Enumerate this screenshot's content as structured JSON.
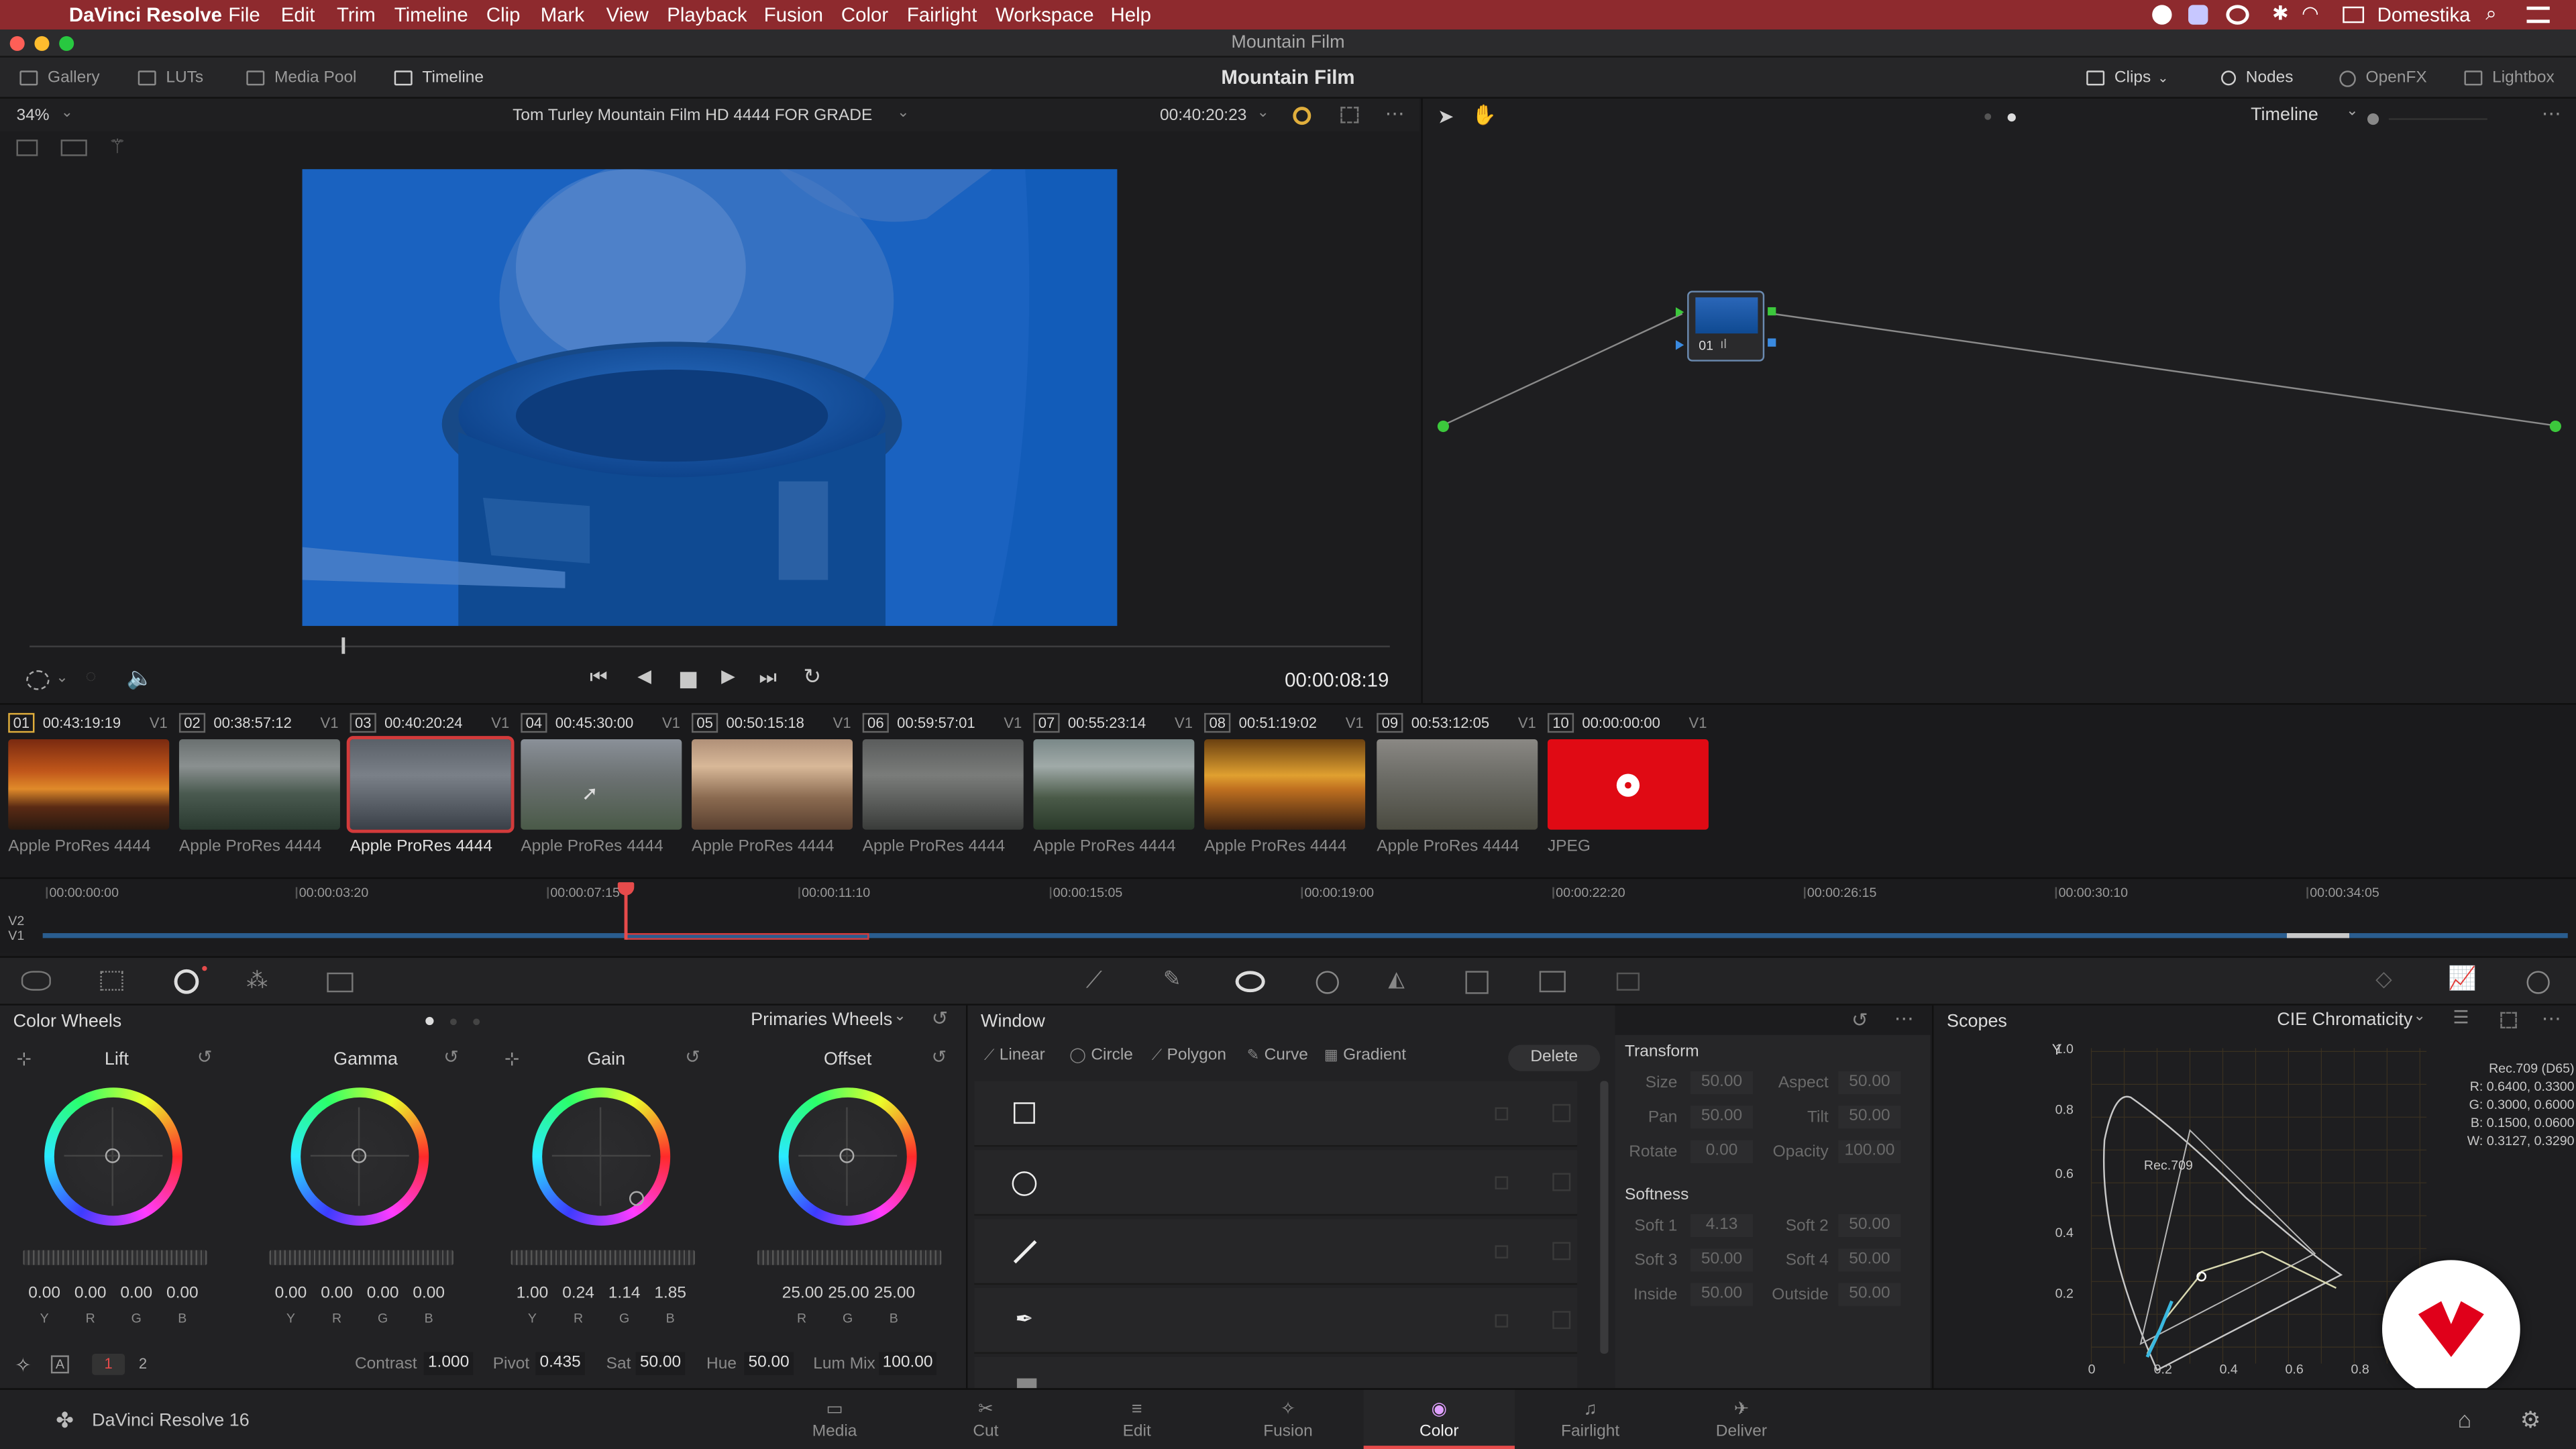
{
  "menubar": {
    "app": "DaVinci Resolve",
    "items": [
      "File",
      "Edit",
      "Trim",
      "Timeline",
      "Clip",
      "Mark",
      "View",
      "Playback",
      "Fusion",
      "Color",
      "Fairlight",
      "Workspace",
      "Help"
    ],
    "user": "Domestika"
  },
  "window_title": "Mountain Film",
  "toolbar": {
    "gallery": "Gallery",
    "luts": "LUTs",
    "media_pool": "Media Pool",
    "timeline": "Timeline",
    "project_title": "Mountain Film",
    "clips": "Clips",
    "nodes": "Nodes",
    "openfx": "OpenFX",
    "lightbox": "Lightbox"
  },
  "viewer": {
    "zoom": "34%",
    "timeline_name": "Tom Turley Mountain Film HD 4444 FOR GRADE",
    "source_tc": "00:40:20:23",
    "record_tc": "00:00:08:19"
  },
  "node_panel": {
    "mode": "Timeline",
    "node_label": "01"
  },
  "clips": [
    {
      "num": "01",
      "tc": "00:43:19:19",
      "track": "V1",
      "codec": "Apple ProRes 4444"
    },
    {
      "num": "02",
      "tc": "00:38:57:12",
      "track": "V1",
      "codec": "Apple ProRes 4444"
    },
    {
      "num": "03",
      "tc": "00:40:20:24",
      "track": "V1",
      "codec": "Apple ProRes 4444"
    },
    {
      "num": "04",
      "tc": "00:45:30:00",
      "track": "V1",
      "codec": "Apple ProRes 4444"
    },
    {
      "num": "05",
      "tc": "00:50:15:18",
      "track": "V1",
      "codec": "Apple ProRes 4444"
    },
    {
      "num": "06",
      "tc": "00:59:57:01",
      "track": "V1",
      "codec": "Apple ProRes 4444"
    },
    {
      "num": "07",
      "tc": "00:55:23:14",
      "track": "V1",
      "codec": "Apple ProRes 4444"
    },
    {
      "num": "08",
      "tc": "00:51:19:02",
      "track": "V1",
      "codec": "Apple ProRes 4444"
    },
    {
      "num": "09",
      "tc": "00:53:12:05",
      "track": "V1",
      "codec": "Apple ProRes 4444"
    },
    {
      "num": "10",
      "tc": "00:00:00:00",
      "track": "V1",
      "codec": "JPEG"
    }
  ],
  "mini_timeline": {
    "ticks": [
      "00:00:00:00",
      "00:00:03:20",
      "00:00:07:15",
      "00:00:11:10",
      "00:00:15:05",
      "00:00:19:00",
      "00:00:22:20",
      "00:00:26:15",
      "00:00:30:10",
      "00:00:34:05"
    ],
    "tracks": [
      "V2",
      "V1"
    ]
  },
  "color_wheels": {
    "title": "Color Wheels",
    "mode": "Primaries Wheels",
    "wheels": [
      {
        "name": "Lift",
        "values": [
          "0.00",
          "0.00",
          "0.00",
          "0.00"
        ],
        "labels": [
          "Y",
          "R",
          "G",
          "B"
        ]
      },
      {
        "name": "Gamma",
        "values": [
          "0.00",
          "0.00",
          "0.00",
          "0.00"
        ],
        "labels": [
          "Y",
          "R",
          "G",
          "B"
        ]
      },
      {
        "name": "Gain",
        "values": [
          "1.00",
          "0.24",
          "1.14",
          "1.85"
        ],
        "labels": [
          "Y",
          "R",
          "G",
          "B"
        ]
      },
      {
        "name": "Offset",
        "values": [
          "25.00",
          "25.00",
          "25.00"
        ],
        "labels": [
          "R",
          "G",
          "B"
        ]
      }
    ],
    "pages": [
      "1",
      "2"
    ],
    "contrast_label": "Contrast",
    "contrast": "1.000",
    "pivot_label": "Pivot",
    "pivot": "0.435",
    "sat_label": "Sat",
    "sat": "50.00",
    "hue_label": "Hue",
    "hue": "50.00",
    "lummix_label": "Lum Mix",
    "lummix": "100.00"
  },
  "window_panel": {
    "title": "Window",
    "tools": [
      "Linear",
      "Circle",
      "Polygon",
      "Curve",
      "Gradient"
    ],
    "delete": "Delete"
  },
  "transform": {
    "title": "Transform",
    "fields": [
      {
        "label": "Size",
        "value": "50.00"
      },
      {
        "label": "Aspect",
        "value": "50.00"
      },
      {
        "label": "Pan",
        "value": "50.00"
      },
      {
        "label": "Tilt",
        "value": "50.00"
      },
      {
        "label": "Rotate",
        "value": "0.00"
      },
      {
        "label": "Opacity",
        "value": "100.00"
      }
    ],
    "softness_title": "Softness",
    "softness": [
      {
        "label": "Soft 1",
        "value": "4.13"
      },
      {
        "label": "Soft 2",
        "value": "50.00"
      },
      {
        "label": "Soft 3",
        "value": "50.00"
      },
      {
        "label": "Soft 4",
        "value": "50.00"
      },
      {
        "label": "Inside",
        "value": "50.00"
      },
      {
        "label": "Outside",
        "value": "50.00"
      }
    ]
  },
  "scopes": {
    "title": "Scopes",
    "mode": "CIE Chromaticity",
    "y_axis": "Y",
    "y_ticks": [
      "1.0",
      "0.8",
      "0.6",
      "0.4",
      "0.2"
    ],
    "x_ticks": [
      "0",
      "0.2",
      "0.4",
      "0.6",
      "0.8"
    ],
    "gamut_label": "Rec.709",
    "info": [
      "Rec.709 (D65)",
      "R: 0.6400, 0.3300",
      "G: 0.3000, 0.6000",
      "B: 0.1500, 0.0600",
      "W: 0.3127, 0.3290"
    ]
  },
  "bottom": {
    "brand": "DaVinci Resolve 16",
    "pages": [
      "Media",
      "Cut",
      "Edit",
      "Fusion",
      "Color",
      "Fairlight",
      "Deliver"
    ],
    "active_page": "Color"
  },
  "colors": {
    "accent": "#e64b4b",
    "menubar": "#8e2a2e",
    "selection": "#d33b3b"
  }
}
